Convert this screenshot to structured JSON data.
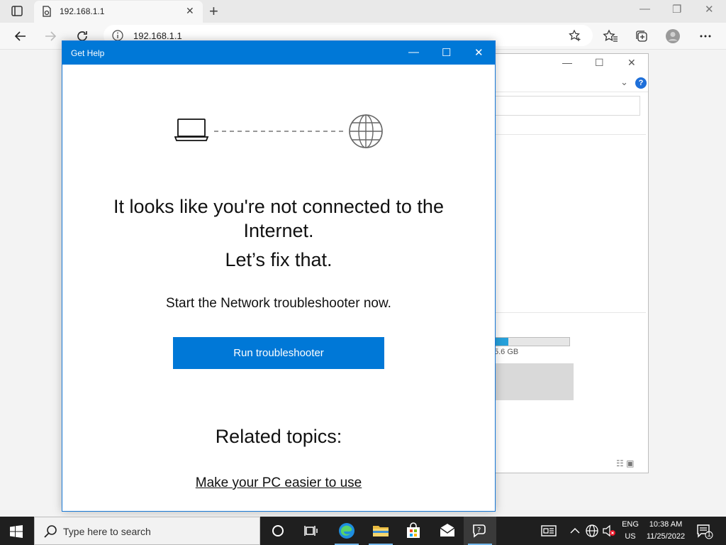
{
  "browser": {
    "tab_title": "192.168.1.1",
    "address": "192.168.1.1"
  },
  "dialog": {
    "title": "Get Help",
    "headline": "It looks like you're not connected to the Internet.",
    "subhead": "Let’s fix that.",
    "body": "Start the Network troubleshooter now.",
    "run_button": "Run troubleshooter",
    "related_heading": "Related topics:",
    "related_link": "Make your PC easier to use"
  },
  "background_window": {
    "storage_text": "5.6 GB",
    "storage_fraction": 0.18,
    "help_glyph": "?"
  },
  "taskbar": {
    "search_placeholder": "Type here to search",
    "lang_top": "ENG",
    "lang_bottom": "US",
    "time": "10:38 AM",
    "date": "11/25/2022",
    "notification_count": "1"
  },
  "colors": {
    "accent": "#0078d7",
    "taskbar": "#1f1f1f"
  },
  "icons": [
    "tab-actions-icon",
    "favicon-icon",
    "close-icon",
    "plus-icon",
    "back-arrow-icon",
    "forward-arrow-icon",
    "refresh-icon",
    "info-icon",
    "favorite-add-icon",
    "favorites-icon",
    "collections-icon",
    "profile-icon",
    "more-icon",
    "laptop-icon",
    "globe-icon",
    "windows-logo-icon",
    "search-icon",
    "task-view-icon",
    "edge-icon",
    "file-explorer-icon",
    "store-icon",
    "mail-icon",
    "get-help-icon",
    "news-icon",
    "chevron-up-icon",
    "network-icon",
    "volume-muted-icon",
    "notification-icon"
  ]
}
